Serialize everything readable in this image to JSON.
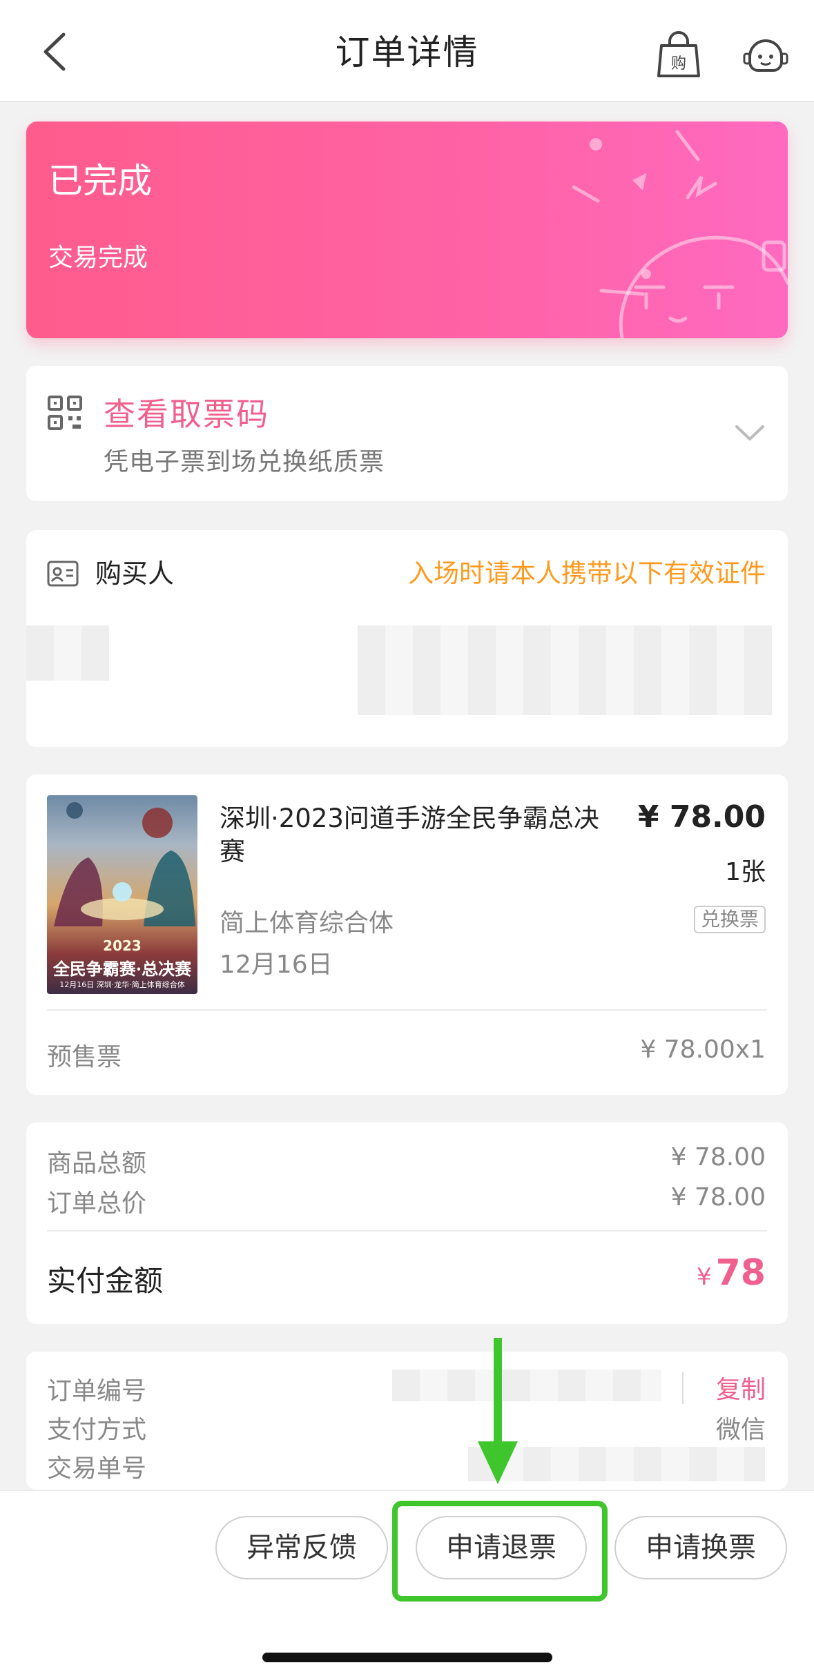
{
  "header": {
    "title": "订单详情",
    "back_icon": "chevron-left-icon",
    "bag_icon": "shopping-bag-icon",
    "service_icon": "customer-service-icon"
  },
  "status": {
    "title": "已完成",
    "subtitle": "交易完成",
    "gradient": [
      "#ff5c8d",
      "#ff6ac0"
    ]
  },
  "ticket_code": {
    "title": "查看取票码",
    "subtitle": "凭电子票到场兑换纸质票",
    "icon": "qr-code-icon",
    "expand_icon": "chevron-down-icon"
  },
  "buyer": {
    "label": "购买人",
    "note": "入场时请本人携带以下有效证件",
    "icon": "id-card-icon"
  },
  "product": {
    "title": "深圳·2023问道手游全民争霸总决赛",
    "price": "¥ 78.00",
    "quantity": "1张",
    "tag": "兑换票",
    "venue": "简上体育综合体",
    "date": "12月16日",
    "poster": {
      "year": "2023",
      "headline": "全民争霸赛·总决赛",
      "caption": "12月16日 深圳·龙华·简上体育综合体"
    },
    "ticket_type": "预售票",
    "ticket_price": "¥ 78.00x1"
  },
  "amounts": {
    "goods_total_label": "商品总额",
    "goods_total": "¥ 78.00",
    "order_total_label": "订单总价",
    "order_total": "¥ 78.00",
    "paid_label": "实付金额",
    "paid_currency": "¥",
    "paid_value": "78"
  },
  "order_info": {
    "order_no_label": "订单编号",
    "copy_label": "复制",
    "pay_method_label": "支付方式",
    "pay_method": "微信",
    "trade_no_label": "交易单号"
  },
  "actions": {
    "feedback": "异常反馈",
    "refund": "申请退票",
    "exchange": "申请换票"
  },
  "colors": {
    "accent": "#f0608f",
    "notice": "#ff9a1e",
    "highlight": "#3ec62c"
  }
}
